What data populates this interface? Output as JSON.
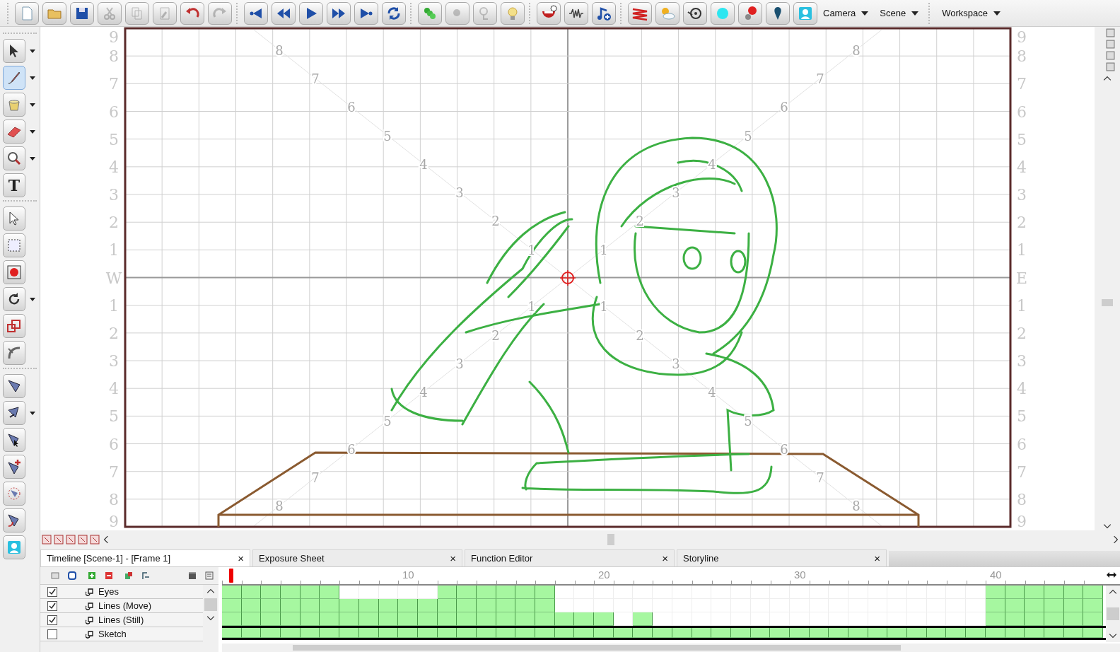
{
  "toolbar": {
    "groups": [
      [
        {
          "kind": "new",
          "disabled": false
        },
        {
          "kind": "open",
          "disabled": false
        },
        {
          "kind": "save",
          "disabled": false
        },
        {
          "kind": "cut",
          "disabled": true
        },
        {
          "kind": "copy",
          "disabled": true
        },
        {
          "kind": "paste",
          "disabled": true
        },
        {
          "kind": "undo",
          "disabled": false
        },
        {
          "kind": "redo",
          "disabled": true
        }
      ],
      [
        {
          "kind": "first",
          "disabled": false
        },
        {
          "kind": "prev",
          "disabled": false
        },
        {
          "kind": "play",
          "disabled": false
        },
        {
          "kind": "next",
          "disabled": false
        },
        {
          "kind": "last",
          "disabled": false
        },
        {
          "kind": "loop",
          "disabled": false
        }
      ],
      [
        {
          "kind": "onion",
          "disabled": false
        },
        {
          "kind": "onion2",
          "disabled": true
        },
        {
          "kind": "light",
          "disabled": true
        },
        {
          "kind": "bulb",
          "disabled": false
        }
      ],
      [
        {
          "kind": "mouth",
          "disabled": false
        },
        {
          "kind": "wave",
          "disabled": false
        },
        {
          "kind": "note",
          "disabled": false
        }
      ],
      [
        {
          "kind": "lines",
          "disabled": false
        },
        {
          "kind": "sun",
          "disabled": false
        },
        {
          "kind": "reel",
          "disabled": false
        },
        {
          "kind": "cyan",
          "disabled": false
        },
        {
          "kind": "redball",
          "disabled": false
        },
        {
          "kind": "drop",
          "disabled": false
        },
        {
          "kind": "person",
          "disabled": false
        }
      ]
    ],
    "menus": [
      {
        "label": "Camera"
      },
      {
        "label": "Scene"
      },
      {
        "label": "Workspace"
      }
    ]
  },
  "tools": [
    [
      {
        "kind": "select",
        "selected": false,
        "dropdown": true
      },
      {
        "kind": "brush",
        "selected": true,
        "dropdown": true
      },
      {
        "kind": "paint",
        "selected": false,
        "dropdown": true
      },
      {
        "kind": "eraser",
        "selected": false,
        "dropdown": true
      },
      {
        "kind": "zoom",
        "selected": false,
        "dropdown": true
      },
      {
        "kind": "text",
        "selected": false,
        "dropdown": false,
        "glyph": "T"
      }
    ],
    [
      {
        "kind": "contour",
        "selected": false,
        "dropdown": false
      },
      {
        "kind": "transform",
        "selected": false,
        "dropdown": false
      },
      {
        "kind": "pivot",
        "selected": false,
        "dropdown": false
      },
      {
        "kind": "rotate",
        "selected": false,
        "dropdown": true
      },
      {
        "kind": "scale",
        "selected": false,
        "dropdown": false
      },
      {
        "kind": "skew",
        "selected": false,
        "dropdown": false
      }
    ],
    [
      {
        "kind": "bone",
        "selected": false,
        "dropdown": false
      },
      {
        "kind": "bone2",
        "selected": false,
        "dropdown": true
      },
      {
        "kind": "bone3",
        "selected": false,
        "dropdown": false
      },
      {
        "kind": "bone4",
        "selected": false,
        "dropdown": false
      },
      {
        "kind": "bone5",
        "selected": false,
        "dropdown": false
      },
      {
        "kind": "bone6",
        "selected": false,
        "dropdown": false
      },
      {
        "kind": "person",
        "selected": false,
        "dropdown": false
      }
    ]
  ],
  "field_guide": {
    "left_labels": [
      "9",
      "8",
      "7",
      "6",
      "5",
      "4",
      "3",
      "2",
      "1",
      "W",
      "1",
      "2",
      "3",
      "4",
      "5",
      "6",
      "7",
      "8",
      "9"
    ],
    "right_labels": [
      "9",
      "8",
      "7",
      "6",
      "5",
      "4",
      "3",
      "2",
      "1",
      "E",
      "1",
      "2",
      "3",
      "4",
      "5",
      "6",
      "7",
      "8",
      "9"
    ],
    "diagonals": [
      {
        "labels": [
          "1",
          "2",
          "3",
          "4",
          "5",
          "6",
          "7",
          "8"
        ]
      },
      {
        "labels": [
          "1",
          "2",
          "3",
          "4",
          "5",
          "6",
          "7",
          "8"
        ]
      },
      {
        "labels": [
          "1",
          "2",
          "3",
          "4",
          "5",
          "6",
          "7",
          "8"
        ]
      },
      {
        "labels": [
          "1",
          "2",
          "3",
          "4",
          "5",
          "6",
          "7",
          "8"
        ]
      }
    ]
  },
  "timeline": {
    "tabs": [
      {
        "label": "Timeline [Scene-1] - [Frame 1]",
        "selected": true,
        "close": "×"
      },
      {
        "label": "Exposure Sheet",
        "selected": false,
        "close": "×"
      },
      {
        "label": "Function Editor",
        "selected": false,
        "close": "×"
      },
      {
        "label": "Storyline",
        "selected": false,
        "close": "×"
      }
    ],
    "ruler_labels": [
      "10",
      "20",
      "30",
      "40"
    ],
    "layers": [
      {
        "name": "Eyes",
        "checked": true,
        "frames": [
          true,
          true,
          true,
          true,
          true,
          true,
          false,
          false,
          false,
          false,
          false,
          true,
          true,
          true,
          true,
          true,
          true,
          false,
          false,
          false,
          false,
          false,
          false,
          false,
          false,
          false,
          false,
          false,
          false,
          false,
          false,
          false,
          false,
          false,
          false,
          false,
          false,
          false,
          false,
          true,
          true,
          true,
          true,
          true,
          true
        ]
      },
      {
        "name": "Lines (Move)",
        "checked": true,
        "frames": [
          true,
          true,
          true,
          true,
          true,
          true,
          true,
          true,
          true,
          true,
          true,
          true,
          true,
          true,
          true,
          true,
          true,
          false,
          false,
          false,
          false,
          false,
          false,
          false,
          false,
          false,
          false,
          false,
          false,
          false,
          false,
          false,
          false,
          false,
          false,
          false,
          false,
          false,
          false,
          true,
          true,
          true,
          true,
          true,
          true
        ]
      },
      {
        "name": "Lines (Still)",
        "checked": true,
        "frames": [
          true,
          true,
          true,
          true,
          true,
          true,
          true,
          true,
          true,
          true,
          true,
          true,
          true,
          true,
          true,
          true,
          true,
          true,
          true,
          true,
          false,
          true,
          false,
          false,
          false,
          false,
          false,
          false,
          false,
          false,
          false,
          false,
          false,
          false,
          false,
          false,
          false,
          false,
          false,
          true,
          true,
          true,
          true,
          true,
          true
        ]
      },
      {
        "name": "Sketch",
        "checked": false,
        "frames": [
          true,
          true,
          true,
          true,
          true,
          true,
          true,
          true,
          true,
          true,
          true,
          true,
          true,
          true,
          true,
          true,
          true,
          true,
          true,
          true,
          true,
          true,
          true,
          true,
          true,
          true,
          true,
          true,
          true,
          true,
          true,
          true,
          true,
          true,
          true,
          true,
          true,
          true,
          true,
          true,
          true,
          true,
          true,
          true,
          true
        ]
      }
    ]
  }
}
